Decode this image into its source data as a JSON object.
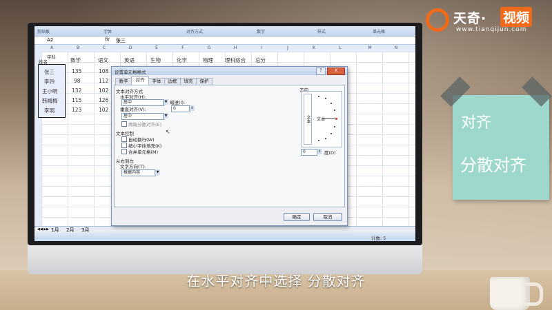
{
  "logo": {
    "text1": "天奇·",
    "text2": "视频",
    "url": "www.tianqijun.com"
  },
  "note": {
    "line1": "对齐",
    "line2": "分散对齐"
  },
  "subtitle": "在水平对齐中选择 分散对齐",
  "excel": {
    "ribbon": [
      "剪贴板",
      "字体",
      "对齐方式",
      "数字",
      "样式",
      "单元格"
    ],
    "namebox": "A2",
    "fx": "fx",
    "formula_value": "张三",
    "col_headers": [
      "A",
      "B",
      "C",
      "D",
      "E",
      "F",
      "G",
      "H",
      "I",
      "J",
      "K",
      "L",
      "M",
      "N"
    ],
    "header_row": [
      "数学",
      "语文",
      "英语",
      "生物",
      "化学",
      "物理",
      "理科综合",
      "总分"
    ],
    "a1_top": "学科",
    "a1_bottom": "姓名",
    "names": [
      "张三",
      "李四",
      "王小明",
      "韩梅梅",
      "李明"
    ],
    "math": [
      "135",
      "98",
      "132",
      "115",
      "123"
    ],
    "chinese": [
      "108",
      "112",
      "102",
      "126",
      "102"
    ],
    "sheets": [
      "1月",
      "2月",
      "3月"
    ],
    "status": "计数: 5"
  },
  "dialog": {
    "title": "设置单元格格式",
    "help": "?",
    "close": "X",
    "tabs": [
      "数字",
      "对齐",
      "字体",
      "边框",
      "填充",
      "保护"
    ],
    "active_tab": "对齐",
    "text_align_section": "文本对齐方式",
    "horizontal_label": "水平对齐(H):",
    "horizontal_value": "居中",
    "indent_label": "缩进(I):",
    "indent_value": "0",
    "vertical_label": "垂直对齐(V):",
    "vertical_value": "居中",
    "justify_distributed": "两端分散对齐(E)",
    "text_control_section": "文本控制",
    "wrap": "自动换行(W)",
    "shrink": "缩小字体填充(K)",
    "merge": "合并单元格(M)",
    "rtl_section": "从右到左",
    "direction_label": "文字方向(T):",
    "direction_value": "根据内容",
    "orientation_label": "方向",
    "vertical_text": "文本",
    "text_sample": "文本",
    "degree_value": "0",
    "degree_label": "度(D)",
    "ok": "确定",
    "cancel": "取消"
  }
}
